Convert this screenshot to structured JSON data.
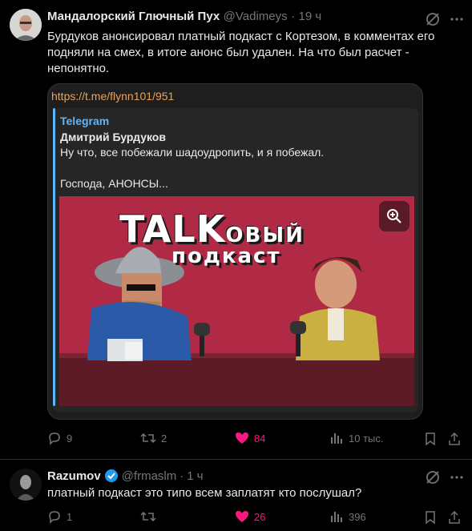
{
  "tweet1": {
    "author_name": "Мандалорский Глючный Пух",
    "handle": "@Vadimeys",
    "sep": "·",
    "time": "19 ч",
    "text_lines": [
      "Бурдуков анонсировал платный подкаст с Кортезом, в комментах его",
      "подняли на смех, в итоге анонс был удален. На что был расчет -",
      "непонятно."
    ],
    "card": {
      "link": "https://t.me/flynn101/951",
      "source": "Telegram",
      "channel_title": "Дмитрий Бурдуков",
      "message_line1": "Ну что, все побежали шадоудропить, и я побежал.",
      "message_line2": "Господа, АНОНСЫ...",
      "image": {
        "title_big": "TALK",
        "title_small": "ОВЫЙ",
        "subtitle": "подкаст"
      }
    },
    "actions": {
      "replies": "9",
      "reposts": "2",
      "likes": "84",
      "views": "10 тыс."
    }
  },
  "tweet2": {
    "author_name": "Razumov",
    "handle": "@frmaslm",
    "sep": "·",
    "time": "1 ч",
    "text": "платный подкаст это типо всем заплатят кто послушал?",
    "actions": {
      "replies": "1",
      "reposts": "",
      "likes": "26",
      "views": "396"
    }
  },
  "colors": {
    "background": "#000000",
    "text": "#e7e9ea",
    "muted": "#71767b",
    "like": "#f91880",
    "link": "#e8a15a",
    "telegram": "#5eb5f7",
    "card_bg": "#1e1e1e",
    "image_bg": "#b12a45",
    "verified": "#1d9bf0"
  }
}
